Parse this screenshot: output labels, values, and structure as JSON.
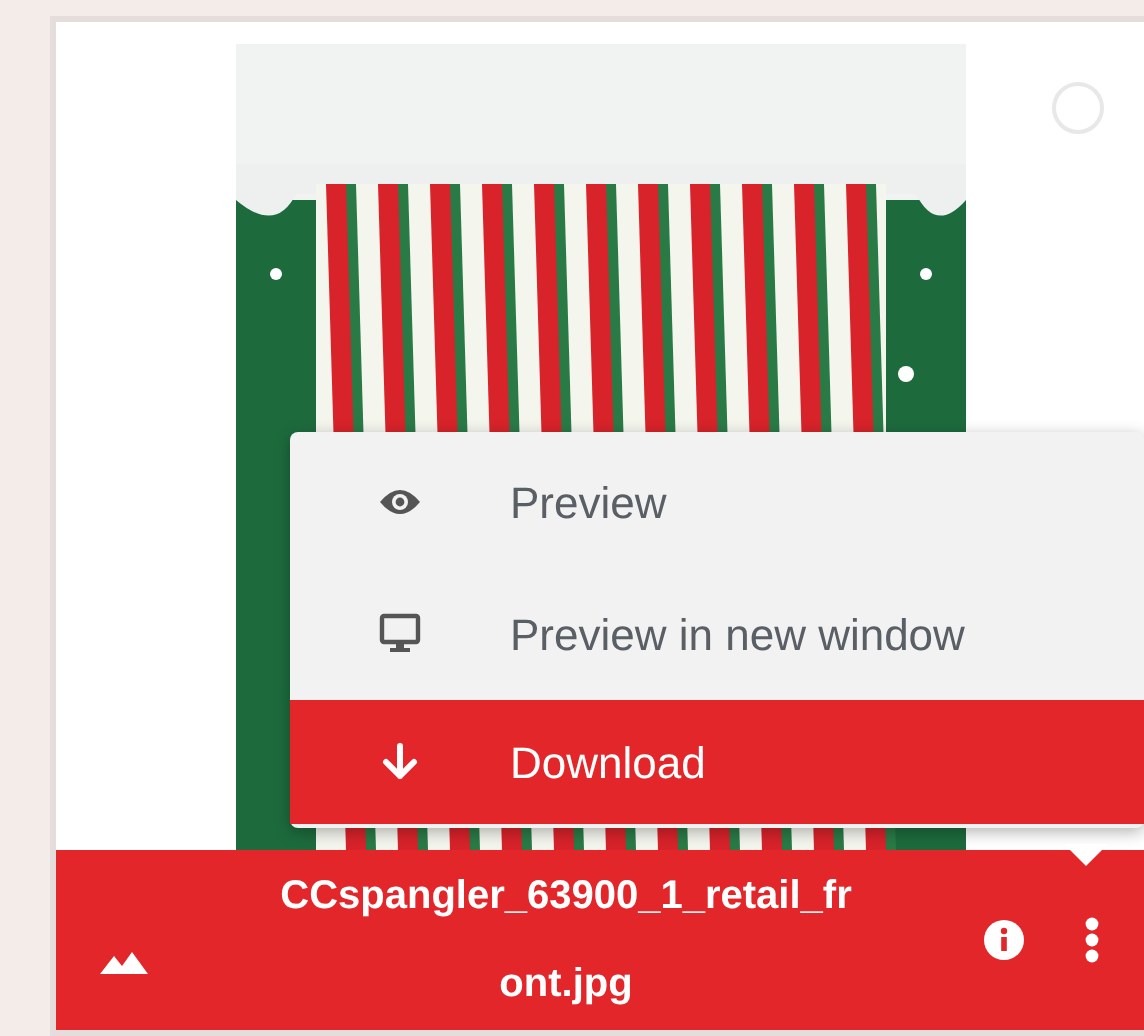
{
  "file_card": {
    "checked": false,
    "file_name": "CCspangler_63900_1_retail_front.jpg"
  },
  "menu": {
    "items": [
      {
        "label": "Preview",
        "kind": "eye",
        "selected": false
      },
      {
        "label": "Preview in new window",
        "kind": "monitor",
        "selected": false
      },
      {
        "label": "Download",
        "kind": "download",
        "selected": true
      }
    ]
  }
}
